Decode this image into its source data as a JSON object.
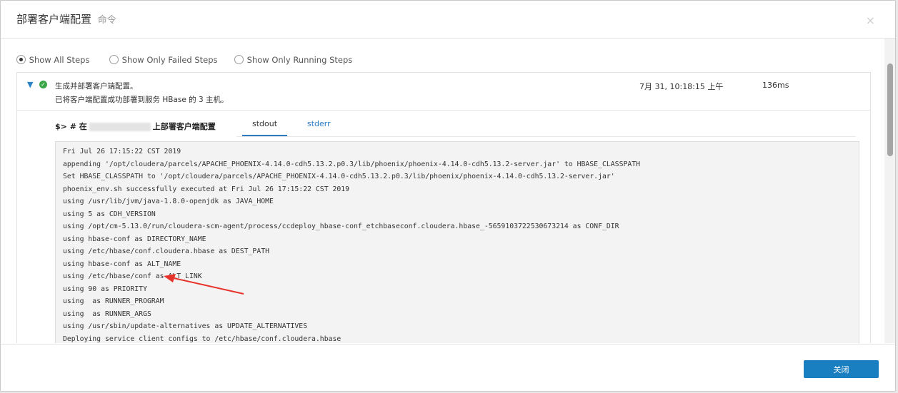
{
  "dialog": {
    "title": "部署客户端配置",
    "subtitle": "命令",
    "close_glyph": "×"
  },
  "filters": [
    {
      "label": "Show All Steps",
      "checked": true
    },
    {
      "label": "Show Only Failed Steps",
      "checked": false
    },
    {
      "label": "Show Only Running Steps",
      "checked": false
    }
  ],
  "step": {
    "expand_icon": "chevron-down-icon",
    "status_icon": "check-circle-icon",
    "status_color": "#3aa648",
    "title": "生成并部署客户端配置。",
    "description": "已将客户端配置成功部署到服务 HBase 的 3 主机。",
    "time": "7月 31, 10:18:15 上午",
    "duration": "136ms",
    "command_prefix": "$> # 在",
    "command_suffix": "上部署客户端配置",
    "tabs": [
      {
        "label": "stdout",
        "active": true
      },
      {
        "label": "stderr",
        "active": false
      }
    ],
    "output": [
      "Fri Jul 26 17:15:22 CST 2019",
      "appending '/opt/cloudera/parcels/APACHE_PHOENIX-4.14.0-cdh5.13.2.p0.3/lib/phoenix/phoenix-4.14.0-cdh5.13.2-server.jar' to HBASE_CLASSPATH",
      "Set HBASE_CLASSPATH to '/opt/cloudera/parcels/APACHE_PHOENIX-4.14.0-cdh5.13.2.p0.3/lib/phoenix/phoenix-4.14.0-cdh5.13.2-server.jar'",
      "phoenix_env.sh successfully executed at Fri Jul 26 17:15:22 CST 2019",
      "using /usr/lib/jvm/java-1.8.0-openjdk as JAVA_HOME",
      "using 5 as CDH_VERSION",
      "using /opt/cm-5.13.0/run/cloudera-scm-agent/process/ccdeploy_hbase-conf_etchbaseconf.cloudera.hbase_-5659103722530673214 as CONF_DIR",
      "using hbase-conf as DIRECTORY_NAME",
      "using /etc/hbase/conf.cloudera.hbase as DEST_PATH",
      "using hbase-conf as ALT_NAME",
      "using /etc/hbase/conf as ALT_LINK",
      "using 90 as PRIORITY",
      "using  as RUNNER_PROGRAM",
      "using  as RUNNER_ARGS",
      "using /usr/sbin/update-alternatives as UPDATE_ALTERNATIVES",
      "Deploying service client configs to /etc/hbase/conf.cloudera.hbase"
    ]
  },
  "footer": {
    "close_label": "关闭"
  },
  "colors": {
    "accent": "#1a7fc1",
    "success": "#3aa648",
    "annotation_arrow": "#e8332a"
  }
}
